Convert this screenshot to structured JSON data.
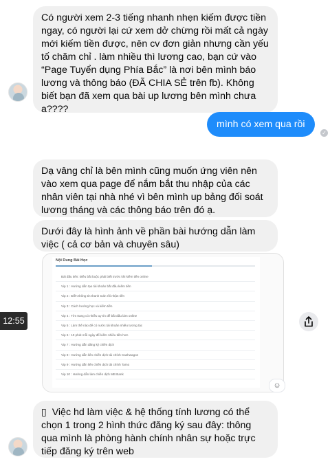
{
  "messages": {
    "m1": "Có người xem 2-3 tiếng nhanh nhẹn kiếm được tiền ngay, có người lại cứ xem dở chừng rồi mất cả ngày mới kiếm tiền được, nên cv đơn giản nhưng cần yếu tố chăm chỉ . làm nhiều thì lương cao, bạn cứ vào “Page Tuyển dụng Phía Bắc” là nơi bên mình báo lương và thông báo (ĐÃ CHIA SẺ trên fb).  Không biết bạn đã xem qua bài up lương bên mình chưa ạ????",
    "m2_out": "mình có xem qua rồi",
    "m3": "Dạ vâng chỉ là bên mình cũng muốn ứng viên nên vào xem qua page để nắm bắt thu nhập của các nhân viên tại nhà nhé vì bên mình up bảng đối soát lương tháng và các thông báo trên đó ạ.",
    "m4": "Dưới đây là hình ảnh về phần  bài hướng dẫn làm việc ( cả cơ bản và chuyên sâu)",
    "m5": "Việc hd làm việc & hệ thống tính lương có thể chọn 1 trong 2 hình thức đăng ký sau đây: thông qua mình là phòng hành chính nhân sự  hoặc trực tiếp đăng ký trên web",
    "m5_prefix": "▯"
  },
  "timestamp": "12:55",
  "image": {
    "header": "Nội Dung Bài Học",
    "items": [
      "Bài đầu tiên: Điều bắt buộc phải biết trước khi kiếm tiền online",
      "Vip 1 : Hướng dẫn tạo tài khoản bắt đầu kiếm tiền",
      "Vip 2 : Điền thông tin thanh toán rồi nhận tiền",
      "Vip 3 : Cách hướng học và kiếm tiền",
      "Vip 4 : Tìm trang có nhiều uy tín để bắt đầu làm online",
      "Vip 5 : Làm thế nào để có nước tài khoản nhiều tương tác",
      "Vip 6 : 10 phút mỗi ngày để kiếm nhiều tiền hơn",
      "Vip 7 : Hướng dẫn đăng ký chiến dịch",
      "Vip 8 : Hướng dẫn liên chiến dịch tài chính Cashwagon",
      "Vip 9 : Hướng dẫn liên chiến dịch tài chính Tamo",
      "Vip 10 : Hướng dẫn làm chiến dịch MB Bank"
    ]
  },
  "colors": {
    "outgoing_bubble": "#1e8cfb",
    "incoming_bubble": "#f0f0f0"
  },
  "icons": {
    "share": "share-icon",
    "react": "emoji-add-icon",
    "seen": "seen-check-icon"
  }
}
